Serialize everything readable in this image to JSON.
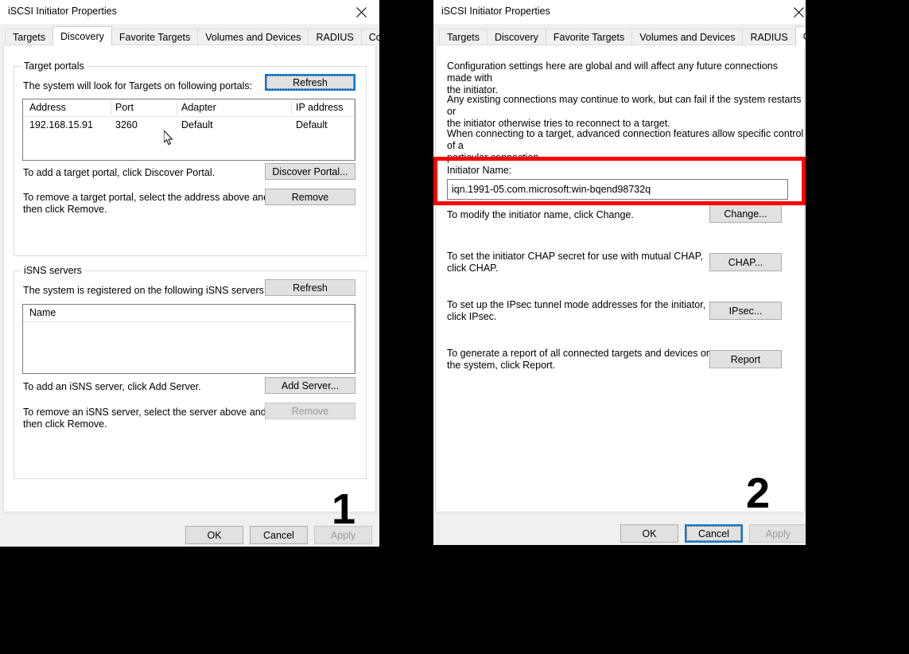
{
  "background_color": "#000000",
  "highlight_color": "#ff0000",
  "accent_color": "#0078d7",
  "dialog_left": {
    "title": "iSCSI Initiator Properties",
    "close_icon": "close-icon",
    "step_number": "1",
    "tabs": [
      {
        "label": "Targets",
        "active": false
      },
      {
        "label": "Discovery",
        "active": true
      },
      {
        "label": "Favorite Targets",
        "active": false
      },
      {
        "label": "Volumes and Devices",
        "active": false
      },
      {
        "label": "RADIUS",
        "active": false
      },
      {
        "label": "Configuration",
        "active": false
      }
    ],
    "target_portals": {
      "legend": "Target portals",
      "description": "The system will look for Targets on following portals:",
      "refresh_label": "Refresh",
      "columns": [
        "Address",
        "Port",
        "Adapter",
        "IP address"
      ],
      "rows": [
        [
          "192.168.15.91",
          "3260",
          "Default",
          "Default"
        ]
      ],
      "add_hint": "To add a target portal, click Discover Portal.",
      "discover_label": "Discover Portal...",
      "remove_hint": "To remove a target portal, select the address above and\nthen click Remove.",
      "remove_label": "Remove"
    },
    "isns_servers": {
      "legend": "iSNS servers",
      "description": "The system is registered on the following iSNS servers:",
      "refresh_label": "Refresh",
      "columns": [
        "Name"
      ],
      "rows": [],
      "add_hint": "To add an iSNS server, click Add Server.",
      "add_label": "Add Server...",
      "remove_hint": "To remove an iSNS server, select the server above and\nthen click Remove.",
      "remove_label": "Remove"
    },
    "footer": {
      "ok_label": "OK",
      "cancel_label": "Cancel",
      "apply_label": "Apply"
    }
  },
  "dialog_right": {
    "title": "iSCSI Initiator Properties",
    "close_icon": "close-icon",
    "step_number": "2",
    "tabs": [
      {
        "label": "Targets",
        "active": false
      },
      {
        "label": "Discovery",
        "active": false
      },
      {
        "label": "Favorite Targets",
        "active": false
      },
      {
        "label": "Volumes and Devices",
        "active": false
      },
      {
        "label": "RADIUS",
        "active": false
      },
      {
        "label": "Configuration",
        "active": true
      }
    ],
    "intro_paragraph_1": "Configuration settings here are global and will affect any future connections made with\nthe initiator.",
    "intro_paragraph_2": "Any existing connections may continue to work, but can fail if the system restarts or\nthe initiator otherwise tries to reconnect to a target.",
    "intro_paragraph_3": "When connecting to a target, advanced connection features allow specific control of a\nparticular connection.",
    "initiator_name_label": "Initiator Name:",
    "initiator_name_value": "iqn.1991-05.com.microsoft:win-bqend98732q",
    "change_hint": "To modify the initiator name, click Change.",
    "change_label": "Change...",
    "chap_hint": "To set the initiator CHAP secret for use with mutual CHAP,\nclick CHAP.",
    "chap_label": "CHAP...",
    "ipsec_hint": "To set up the IPsec tunnel mode addresses for the initiator,\nclick IPsec.",
    "ipsec_label": "IPsec...",
    "report_hint": "To generate a report of all connected targets and devices on\nthe system, click Report.",
    "report_label": "Report",
    "footer": {
      "ok_label": "OK",
      "cancel_label": "Cancel",
      "apply_label": "Apply"
    }
  }
}
